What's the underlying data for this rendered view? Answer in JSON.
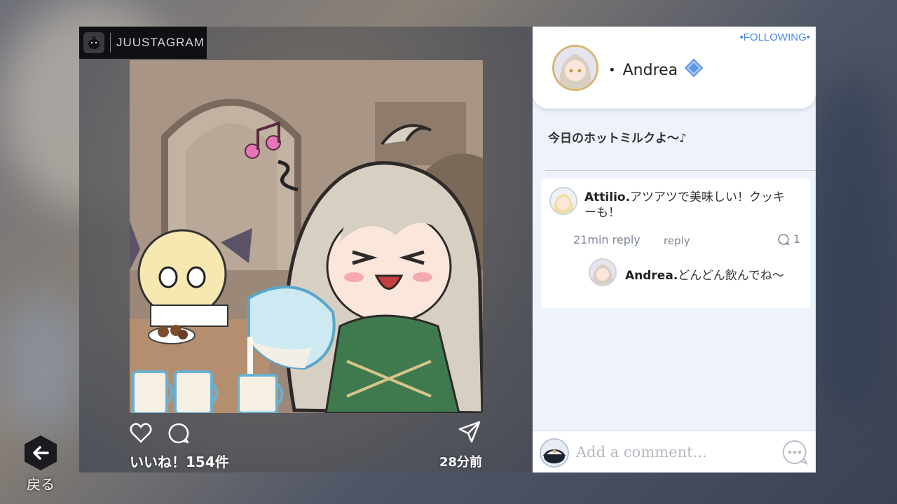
{
  "brand": {
    "name": "JUUSTAGRAM"
  },
  "back": {
    "label": "戻る"
  },
  "post": {
    "likes": "いいね！154件",
    "time_ago": "28分前",
    "icons": [
      "heart-icon",
      "comment-icon",
      "share-icon"
    ]
  },
  "profile": {
    "following": "•FOLLOWING•",
    "bullet": "•",
    "name": "Andrea"
  },
  "caption": "今日のホットミルクよ～♪",
  "comments": [
    {
      "user": "Attilio.",
      "text": "アツアツで美味しい！クッキーも！",
      "time": "21min reply",
      "reply_label": "reply",
      "reply_count": "1",
      "reply": {
        "user": "Andrea.",
        "text": "どんどん飲んでね～"
      }
    }
  ],
  "input": {
    "placeholder": "Add a comment..."
  },
  "colors": {
    "accent": "#4a88e6",
    "panel_bg": "#eef3fb",
    "avatar_ring": "#d6b774"
  }
}
